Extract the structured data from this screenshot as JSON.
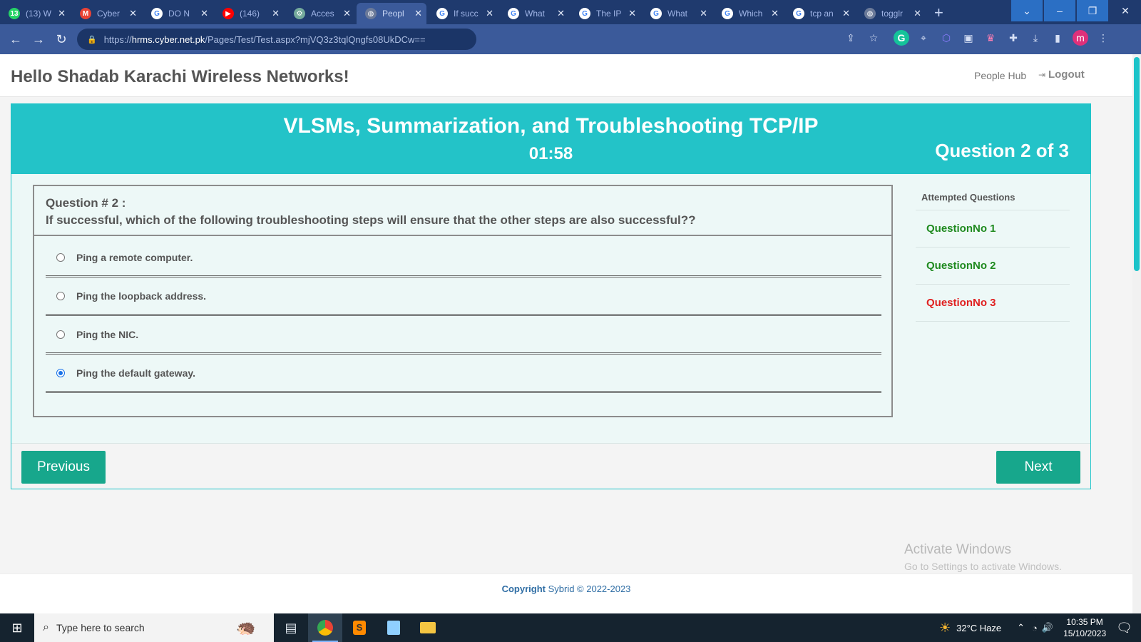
{
  "browser": {
    "tabs": [
      {
        "title": "(13) W",
        "icon": "whatsapp-icon",
        "color": "#25d366",
        "glyph": "13"
      },
      {
        "title": "Cyber",
        "icon": "gmail-icon",
        "color": "#ea4335",
        "glyph": "M"
      },
      {
        "title": "DO N",
        "icon": "google-icon",
        "color": "#ffffff",
        "glyph": "G"
      },
      {
        "title": "(146)",
        "icon": "youtube-icon",
        "color": "#ff0000",
        "glyph": "▶"
      },
      {
        "title": "Acces",
        "icon": "openai-icon",
        "color": "#74aa9c",
        "glyph": "⚙"
      },
      {
        "title": "Peopl",
        "icon": "globe-icon",
        "color": "#6b7a99",
        "glyph": "◍",
        "active": true
      },
      {
        "title": "If succ",
        "icon": "google-icon",
        "color": "#ffffff",
        "glyph": "G"
      },
      {
        "title": "What",
        "icon": "google-icon",
        "color": "#ffffff",
        "glyph": "G"
      },
      {
        "title": "The IP",
        "icon": "google-icon",
        "color": "#ffffff",
        "glyph": "G"
      },
      {
        "title": "What",
        "icon": "google-icon",
        "color": "#ffffff",
        "glyph": "G"
      },
      {
        "title": "Which",
        "icon": "google-icon",
        "color": "#ffffff",
        "glyph": "G"
      },
      {
        "title": "tcp an",
        "icon": "google-icon",
        "color": "#ffffff",
        "glyph": "G"
      },
      {
        "title": "togglr",
        "icon": "globe-icon",
        "color": "#6b7a99",
        "glyph": "◍"
      }
    ],
    "url_host": "hrms.cyber.net.pk",
    "url_path": "/Pages/Test/Test.aspx?mjVQ3z3tqlQngfs08UkDCw==",
    "url_scheme": "https://",
    "profile_initial": "m"
  },
  "header": {
    "greeting": "Hello Shadab Karachi Wireless Networks!",
    "people_hub": "People Hub",
    "logout": "Logout"
  },
  "test": {
    "title": "VLSMs, Summarization, and Troubleshooting TCP/IP",
    "timer": "01:58",
    "counter": "Question 2 of 3",
    "question_number": "Question # 2 :",
    "question_text": "If successful, which of the following troubleshooting steps will ensure that the other steps are also successful??",
    "options": [
      {
        "label": "Ping a remote computer.",
        "selected": false
      },
      {
        "label": "Ping the loopback address.",
        "selected": false
      },
      {
        "label": "Ping the NIC.",
        "selected": false
      },
      {
        "label": "Ping the default gateway.",
        "selected": true
      }
    ],
    "previous_label": "Previous",
    "next_label": "Next"
  },
  "attempted": {
    "heading": "Attempted Questions",
    "items": [
      {
        "label": "QuestionNo 1",
        "status": "attempted",
        "color": "#1f8a1f"
      },
      {
        "label": "QuestionNo 2",
        "status": "attempted",
        "color": "#1f8a1f"
      },
      {
        "label": "QuestionNo 3",
        "status": "not-attempted",
        "color": "#e02020"
      }
    ]
  },
  "watermark": {
    "line1": "Activate Windows",
    "line2": "Go to Settings to activate Windows."
  },
  "footer": {
    "copyright_label": "Copyright",
    "copyright_rest": "Sybrid © 2022-2023"
  },
  "taskbar": {
    "search_placeholder": "Type here to search",
    "weather": "32°C  Haze",
    "time": "10:35 PM",
    "date": "15/10/2023"
  },
  "colors": {
    "accent_teal": "#23c3c8",
    "button_green": "#17a78c",
    "attempted_green": "#1f8a1f",
    "unattempted_red": "#e02020"
  }
}
